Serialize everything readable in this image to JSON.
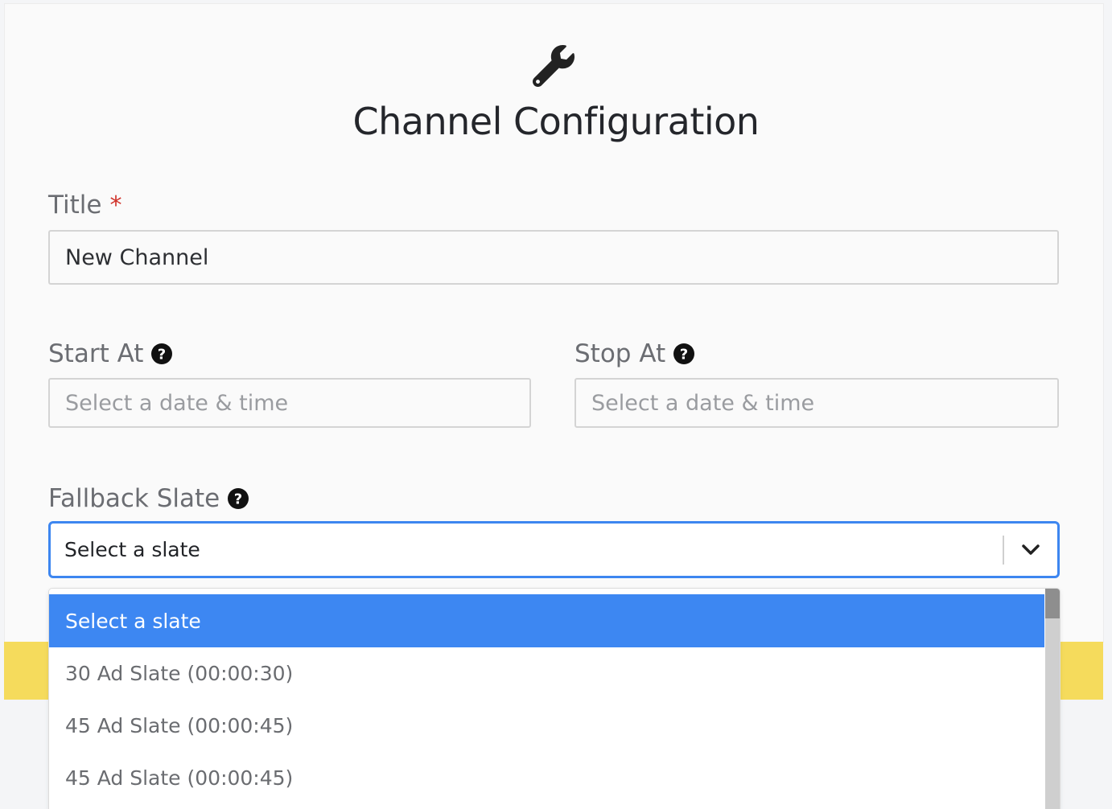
{
  "form": {
    "title": "Channel Configuration",
    "icon": "wrench-icon",
    "title_field": {
      "label": "Title",
      "required_marker": "*",
      "value": "New Channel"
    },
    "start_at": {
      "label": "Start At",
      "placeholder": "Select a date & time"
    },
    "stop_at": {
      "label": "Stop At",
      "placeholder": "Select a date & time"
    },
    "fallback_slate": {
      "label": "Fallback Slate",
      "selected": "Select a slate",
      "options": [
        "Select a slate",
        "30 Ad Slate (00:00:30)",
        "45 Ad Slate (00:00:45)",
        "45 Ad Slate (00:00:45)"
      ]
    }
  },
  "colors": {
    "accent": "#3d87f2",
    "required": "#d0342c",
    "footer": "#f5db5c"
  }
}
